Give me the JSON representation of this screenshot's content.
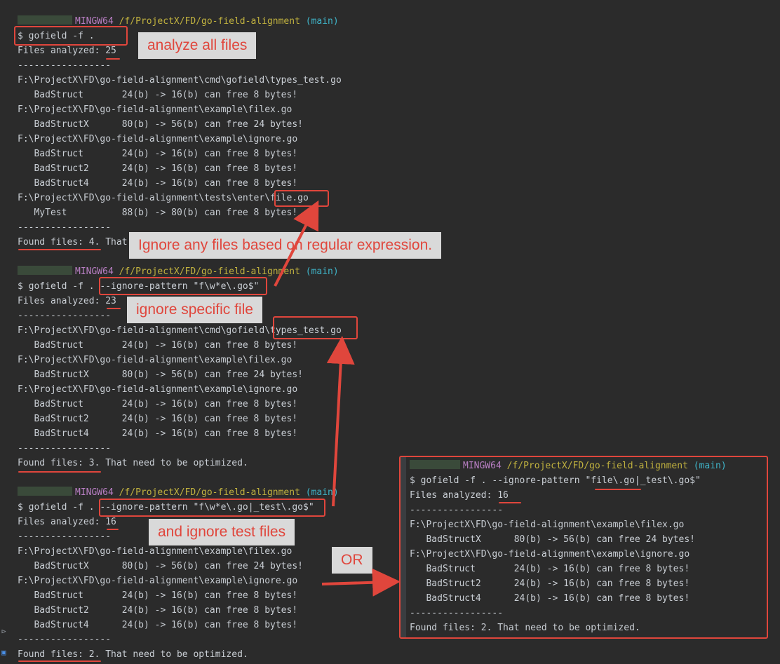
{
  "prompt": {
    "mingw": "MINGW64",
    "path": "/f/ProjectX/FD/go-field-alignment",
    "branch": "(main)"
  },
  "block1": {
    "command": "$ gofield -f .",
    "analyzed": "Files analyzed: 25",
    "separator": "-----------------",
    "lines": [
      "F:\\ProjectX\\FD\\go-field-alignment\\cmd\\gofield\\types_test.go",
      "   BadStruct       24(b) -> 16(b) can free 8 bytes!",
      "F:\\ProjectX\\FD\\go-field-alignment\\example\\filex.go",
      "   BadStructX      80(b) -> 56(b) can free 24 bytes!",
      "F:\\ProjectX\\FD\\go-field-alignment\\example\\ignore.go",
      "   BadStruct       24(b) -> 16(b) can free 8 bytes!",
      "   BadStruct2      24(b) -> 16(b) can free 8 bytes!",
      "   BadStruct4      24(b) -> 16(b) can free 8 bytes!",
      "F:\\ProjectX\\FD\\go-field-alignment\\tests\\enter\\file.go",
      "   MyTest          88(b) -> 80(b) can free 8 bytes!"
    ],
    "found": "Found files: 4. That need to be optimized."
  },
  "block2": {
    "command": "$ gofield -f . --ignore-pattern \"f\\w*e\\.go$\"",
    "analyzed": "Files analyzed: 23",
    "separator": "-----------------",
    "lines": [
      "F:\\ProjectX\\FD\\go-field-alignment\\cmd\\gofield\\types_test.go",
      "   BadStruct       24(b) -> 16(b) can free 8 bytes!",
      "F:\\ProjectX\\FD\\go-field-alignment\\example\\filex.go",
      "   BadStructX      80(b) -> 56(b) can free 24 bytes!",
      "F:\\ProjectX\\FD\\go-field-alignment\\example\\ignore.go",
      "   BadStruct       24(b) -> 16(b) can free 8 bytes!",
      "   BadStruct2      24(b) -> 16(b) can free 8 bytes!",
      "   BadStruct4      24(b) -> 16(b) can free 8 bytes!"
    ],
    "found": "Found files: 3. That need to be optimized."
  },
  "block3": {
    "command": "$ gofield -f . --ignore-pattern \"f\\w*e\\.go|_test\\.go$\"",
    "analyzed": "Files analyzed: 16",
    "separator": "-----------------",
    "lines": [
      "F:\\ProjectX\\FD\\go-field-alignment\\example\\filex.go",
      "   BadStructX      80(b) -> 56(b) can free 24 bytes!",
      "F:\\ProjectX\\FD\\go-field-alignment\\example\\ignore.go",
      "   BadStruct       24(b) -> 16(b) can free 8 bytes!",
      "   BadStruct2      24(b) -> 16(b) can free 8 bytes!",
      "   BadStruct4      24(b) -> 16(b) can free 8 bytes!"
    ],
    "found": "Found files: 2. That need to be optimized."
  },
  "block4": {
    "command": "$ gofield -f . --ignore-pattern \"file\\.go|_test\\.go$\"",
    "analyzed": "Files analyzed: 16",
    "separator": "-----------------",
    "lines": [
      "F:\\ProjectX\\FD\\go-field-alignment\\example\\filex.go",
      "   BadStructX      80(b) -> 56(b) can free 24 bytes!",
      "F:\\ProjectX\\FD\\go-field-alignment\\example\\ignore.go",
      "   BadStruct       24(b) -> 16(b) can free 8 bytes!",
      "   BadStruct2      24(b) -> 16(b) can free 8 bytes!",
      "   BadStruct4      24(b) -> 16(b) can free 8 bytes!"
    ],
    "found": "Found files: 2. That need to be optimized."
  },
  "callouts": {
    "analyze_all": "analyze all files",
    "ignore_regex": "Ignore any files based on regular expression.",
    "ignore_specific": "ignore specific file",
    "ignore_tests": "and ignore test files",
    "or": "OR"
  },
  "colors": {
    "background": "#2b2b2b",
    "text": "#c9ced4",
    "mingw": "#b97fc4",
    "path": "#c1b23f",
    "branch": "#3fb4c8",
    "annotation_red": "#e0463c",
    "callout_bg": "#d9d9d9"
  },
  "icons": [
    "terminal-gutter-icon",
    "selected-gutter-icon"
  ]
}
